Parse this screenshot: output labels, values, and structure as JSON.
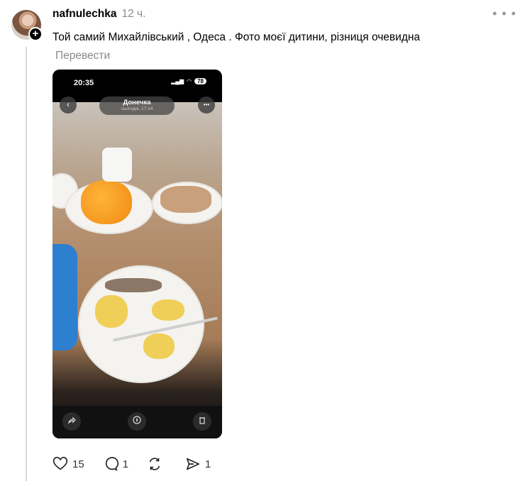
{
  "post": {
    "username": "nafnulechka",
    "time": "12 ч.",
    "text": "Той самий Михайлівський , Одеса . Фото моєї дитини, різниця очевидна",
    "translate_label": "Перевести",
    "more_label": "• • •",
    "follow_label": "+"
  },
  "media": {
    "status_time": "20:35",
    "battery": "78",
    "contact_name": "Донечка",
    "contact_time": "сьогодні, 17:14",
    "back_label": "‹",
    "menu_label": "•••",
    "bottom_buttons": [
      "share-icon",
      "flame-icon",
      "trash-icon"
    ]
  },
  "actions": {
    "likes": "15",
    "replies": "1",
    "reposts": "",
    "shares": "1"
  }
}
